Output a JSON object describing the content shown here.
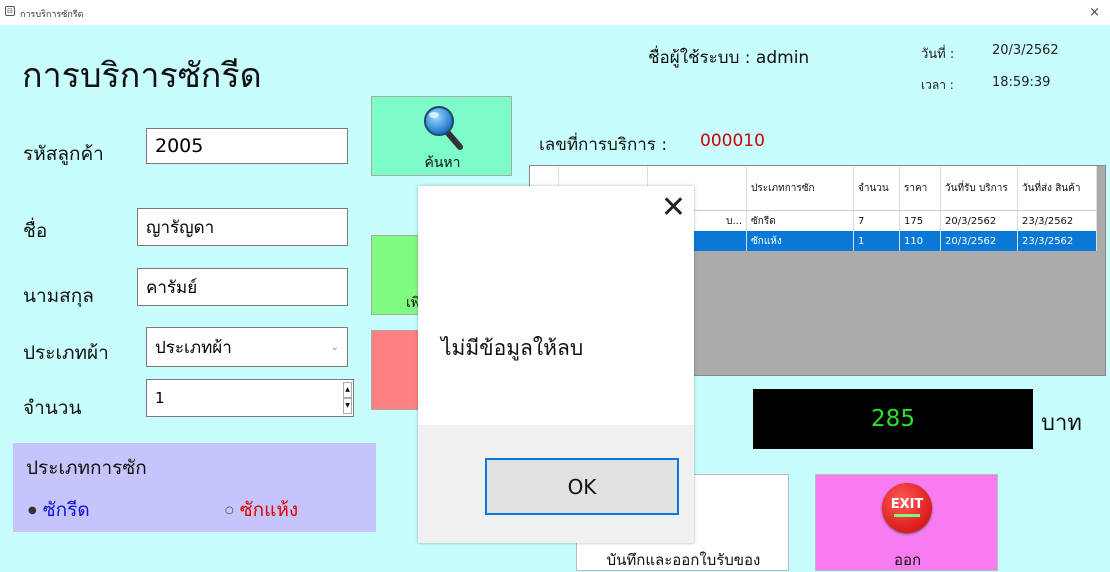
{
  "window": {
    "title": "การบริการซักรีด",
    "close_glyph": "×"
  },
  "heading": "การบริการซักรีด",
  "user": {
    "label": "ชื่อผู้ใช้ระบบ : admin",
    "date_label": "วันที่ :",
    "date_value": "20/3/2562",
    "time_label": "เวลา :",
    "time_value": "18:59:39"
  },
  "form": {
    "customer_id_label": "รหัสลูกค้า",
    "customer_id_value": "2005",
    "name_label": "ชื่อ",
    "name_value": "ญารัญดา",
    "surname_label": "นามสกุล",
    "surname_value": "คารัมย์",
    "cloth_type_label": "ประเภทผ้า",
    "cloth_type_value": "ประเภทผ้า",
    "quantity_label": "จำนวน",
    "quantity_value": "1"
  },
  "search_button": {
    "label": "ค้นหา",
    "icon": "magnifier-icon"
  },
  "add_button": {
    "label_fragment": "เพิ"
  },
  "service": {
    "no_label": "เลขที่การบริการ :",
    "no_value": "000010",
    "no_color": "#d00000"
  },
  "grid": {
    "columns": [
      "",
      "",
      "ประเภทการซัก",
      "จำนวน",
      "ราคา",
      "วันที่รับ บริการ",
      "วันที่ส่ง สินค้า"
    ],
    "rows": [
      {
        "c1": "",
        "c2": "บ...",
        "type": "ซักรีด",
        "qty": "7",
        "price": "175",
        "recv": "20/3/2562",
        "send": "23/3/2562",
        "selected": false
      },
      {
        "c1": "",
        "c2": "",
        "type": "ซักแห้ง",
        "qty": "1",
        "price": "110",
        "recv": "20/3/2562",
        "send": "23/3/2562",
        "selected": true
      }
    ]
  },
  "total": {
    "value": "285",
    "unit": "บาท"
  },
  "wash_type": {
    "title": "ประเภทการซัก",
    "option1": "ซักรีด",
    "option2": "ซักแห้ง",
    "option1_color": "#1010e0",
    "option2_color": "#e00000"
  },
  "save_button": {
    "label": "บันทึกและออกใบรับของ"
  },
  "exit_button": {
    "label": "ออก",
    "icon_text": "EXIT"
  },
  "dialog": {
    "message": "ไม่มีข้อมูลให้ลบ",
    "ok_label": "OK",
    "close_glyph": "✕"
  }
}
